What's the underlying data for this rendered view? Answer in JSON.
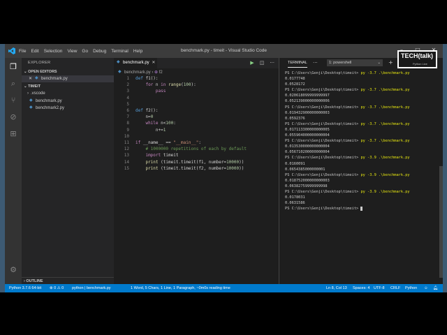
{
  "window": {
    "title": "benchmark.py - timeit - Visual Studio Code",
    "menu": [
      "File",
      "Edit",
      "Selection",
      "View",
      "Go",
      "Debug",
      "Terminal",
      "Help"
    ]
  },
  "sidebar": {
    "header": "EXPLORER",
    "open_editors": {
      "title": "OPEN EDITORS",
      "items": [
        {
          "label": "benchmark.py"
        }
      ]
    },
    "folder": {
      "title": "TIMEIT",
      "items": [
        {
          "label": ".vscode"
        },
        {
          "label": "benchmark.py"
        },
        {
          "label": "benchmark2.py"
        }
      ]
    },
    "outline": "OUTLINE"
  },
  "editor": {
    "tab": "benchmark.py",
    "breadcrumb": {
      "file": "benchmark.py",
      "symbol": "f2"
    },
    "lines": [
      {
        "n": "1",
        "code": "def f1():"
      },
      {
        "n": "2",
        "code": "    for n in range(100):"
      },
      {
        "n": "3",
        "code": "        pass"
      },
      {
        "n": "4",
        "code": ""
      },
      {
        "n": "5",
        "code": ""
      },
      {
        "n": "6",
        "code": "def f2():"
      },
      {
        "n": "7",
        "code": "    n=0"
      },
      {
        "n": "8",
        "code": "    while n<100:"
      },
      {
        "n": "9",
        "code": "        n+=1"
      },
      {
        "n": "10",
        "code": ""
      },
      {
        "n": "11",
        "code": "if __name__ == \"__main__\":"
      },
      {
        "n": "12",
        "code": "    # 1000000 repetitions of each by default"
      },
      {
        "n": "13",
        "code": "    import timeit"
      },
      {
        "n": "14",
        "code": "    print (timeit.timeit(f1, number=10000))"
      },
      {
        "n": "15",
        "code": "    print (timeit.timeit(f2, number=10000))"
      }
    ]
  },
  "panel": {
    "tab": "TERMINAL",
    "dots": "···",
    "shell": "1: powershell",
    "prompt": "PS C:\\Users\\Genji\\Desktop\\timeit> ",
    "lines": [
      {
        "cmd": "py -3.7 .\\benchmark.py"
      },
      {
        "out": "0.0177748"
      },
      {
        "out": "0.0528172"
      },
      {
        "cmd": "py -3.7 .\\benchmark.py"
      },
      {
        "out": "0.020618099999999997"
      },
      {
        "out": "0.052139000000000006"
      },
      {
        "cmd": "py -3.7 .\\benchmark.py"
      },
      {
        "out": "0.019432900000000003"
      },
      {
        "out": "0.0592376"
      },
      {
        "cmd": "py -3.7 .\\benchmark.py"
      },
      {
        "out": "0.017113300000000005"
      },
      {
        "out": "0.055904000000000004"
      },
      {
        "cmd": "py -3.7 .\\benchmark.py"
      },
      {
        "out": "0.013530000000000004"
      },
      {
        "out": "0.056710200000000004"
      },
      {
        "cmd": "py -3.9 .\\benchmark.py"
      },
      {
        "out": "0.0160091"
      },
      {
        "out": "0.0654385000000001"
      },
      {
        "cmd": "py -3.9 .\\benchmark.py"
      },
      {
        "out": "0.018752000000000003"
      },
      {
        "out": "0.06382759999999998"
      },
      {
        "cmd": "py -3.9 .\\benchmark.py"
      },
      {
        "out": "0.0178031"
      },
      {
        "out": "0.0631586"
      },
      {
        "cmd": ""
      }
    ]
  },
  "statusbar": {
    "python": "Python 3.7.6 64-bit",
    "errors": "⊗ 0 ⚠ 0",
    "task": "python | benchmark.py",
    "words": "1 Word, 5 Chars, 1 Line, 1 Paragraph, ~0m0s reading time",
    "position": "Ln 8, Col 13",
    "spaces": "Spaces: 4",
    "encoding": "UTF-8",
    "eol": "CRLF",
    "language": "Python"
  },
  "overlay": {
    "title": "TECH(talk)",
    "sub": "Python Live"
  }
}
